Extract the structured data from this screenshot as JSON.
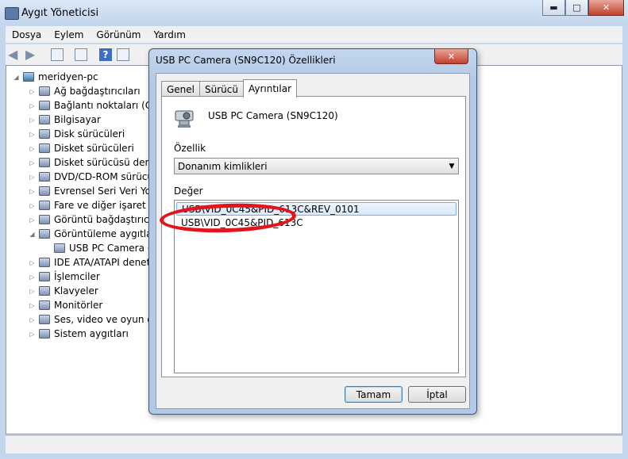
{
  "window": {
    "title": "Aygıt Yöneticisi",
    "controls": {
      "minimize": "▬",
      "maximize": "□",
      "close": "✕"
    }
  },
  "menu": [
    "Dosya",
    "Eylem",
    "Görünüm",
    "Yardım"
  ],
  "tree": {
    "root": "meridyen-pc",
    "items": [
      {
        "label": "Ağ bağdaştırıcıları",
        "icon": "network-adapter-icon"
      },
      {
        "label": "Bağlantı noktaları (COM",
        "icon": "port-icon"
      },
      {
        "label": "Bilgisayar",
        "icon": "computer-icon"
      },
      {
        "label": "Disk sürücüleri",
        "icon": "disk-drive-icon"
      },
      {
        "label": "Disket sürücüleri",
        "icon": "floppy-drive-icon"
      },
      {
        "label": "Disket sürücüsü denet",
        "icon": "floppy-controller-icon"
      },
      {
        "label": "DVD/CD-ROM sürücü",
        "icon": "dvd-drive-icon"
      },
      {
        "label": "Evrensel Seri Veri Yolu",
        "icon": "usb-controller-icon"
      },
      {
        "label": "Fare ve diğer işaret ayg",
        "icon": "mouse-icon"
      },
      {
        "label": "Görüntü bağdaştırıcılar",
        "icon": "display-adapter-icon"
      },
      {
        "label": "Görüntüleme aygıtları",
        "icon": "imaging-device-icon",
        "expanded": true
      },
      {
        "label": "USB PC Camera (SN",
        "icon": "camera-icon",
        "child": true
      },
      {
        "label": "IDE ATA/ATAPI denetl",
        "icon": "ide-controller-icon"
      },
      {
        "label": "İşlemciler",
        "icon": "processor-icon"
      },
      {
        "label": "Klavyeler",
        "icon": "keyboard-icon"
      },
      {
        "label": "Monitörler",
        "icon": "monitor-icon"
      },
      {
        "label": "Ses, video ve oyun den",
        "icon": "sound-icon"
      },
      {
        "label": "Sistem aygıtları",
        "icon": "system-device-icon"
      }
    ]
  },
  "dialog": {
    "title": "USB PC Camera (SN9C120) Özellikleri",
    "tabs": [
      "Genel",
      "Sürücü",
      "Ayrıntılar"
    ],
    "active_tab": "Ayrıntılar",
    "device_name": "USB PC Camera (SN9C120)",
    "property_label": "Özellik",
    "property_value": "Donanım kimlikleri",
    "value_label": "Değer",
    "values": [
      "USB\\VID_0C45&PID_613C&REV_0101",
      "USB\\VID_0C45&PID_613C"
    ],
    "ok": "Tamam",
    "cancel": "İptal"
  },
  "colors": {
    "highlight_ellipse": "#e3141b"
  }
}
